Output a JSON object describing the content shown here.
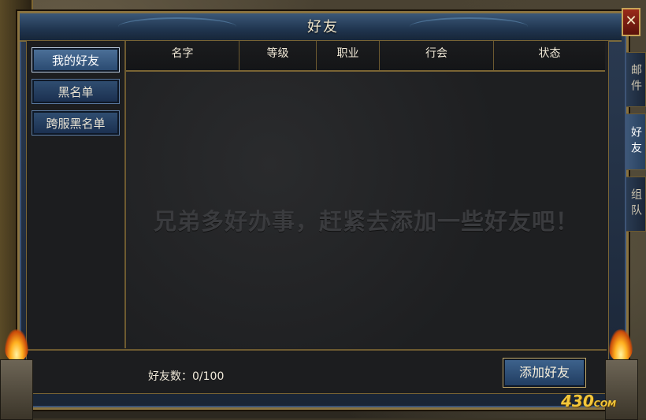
{
  "window": {
    "title": "好友",
    "close_label": "✕"
  },
  "nav": {
    "items": [
      {
        "label": "我的好友",
        "active": true
      },
      {
        "label": "黑名单",
        "active": false
      },
      {
        "label": "跨服黑名单",
        "active": false
      }
    ]
  },
  "table": {
    "columns": [
      "名字",
      "等级",
      "职业",
      "行会",
      "状态"
    ],
    "rows": [],
    "empty_message": "兄弟多好办事，赶紧去添加一些好友吧！"
  },
  "footer": {
    "friend_count": "好友数：0/100",
    "add_button": "添加好友"
  },
  "side_tabs": [
    {
      "label": "邮件",
      "active": false
    },
    {
      "label": "好友",
      "active": true
    },
    {
      "label": "组队",
      "active": false
    }
  ],
  "watermark": {
    "main": "430",
    "suffix": "COM"
  },
  "colors": {
    "frame_gold": "#8a7340",
    "title_blue": "#3b5878",
    "panel_dark": "#1f2022",
    "text_light": "#f0e8d6"
  }
}
